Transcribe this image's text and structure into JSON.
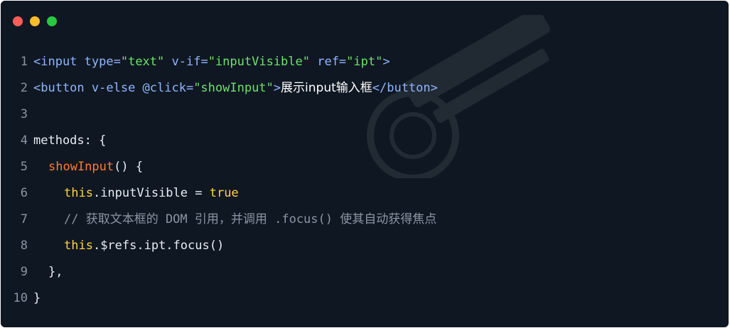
{
  "window": {
    "controls": [
      "close",
      "minimize",
      "maximize"
    ]
  },
  "code": {
    "line_numbers": [
      "1",
      "2",
      "3",
      "4",
      "5",
      "6",
      "7",
      "8",
      "9",
      "10"
    ],
    "l1": {
      "open": "<input",
      "type_attr": " type=",
      "type_val": "\"text\"",
      "vif_attr": " v-if=",
      "vif_val": "\"inputVisible\"",
      "ref_attr": " ref=",
      "ref_val": "\"ipt\"",
      "close": ">"
    },
    "l2": {
      "open": "<button",
      "velse_attr": " v-else @click=",
      "click_val": "\"showInput\"",
      "gt": ">",
      "text": "展示input输入框",
      "close": "</button>"
    },
    "l4": {
      "text": "methods: {"
    },
    "l5": {
      "fn": "showInput",
      "rest": "() {"
    },
    "l6": {
      "kw": "this",
      "mid": ".inputVisible = ",
      "val": "true"
    },
    "l7": {
      "comment": "// 获取文本框的 DOM 引用，并调用 .focus() 使其自动获得焦点"
    },
    "l8": {
      "kw": "this",
      "rest": ".$refs.ipt.focus()"
    },
    "l9": {
      "text": "},"
    },
    "l10": {
      "text": "}"
    }
  },
  "colors": {
    "background": "#0f1722",
    "tag": "#8fb5ff",
    "string": "#6ee26b",
    "keyword": "#ffd447",
    "function": "#ff7a33",
    "comment": "#8b95a1"
  }
}
